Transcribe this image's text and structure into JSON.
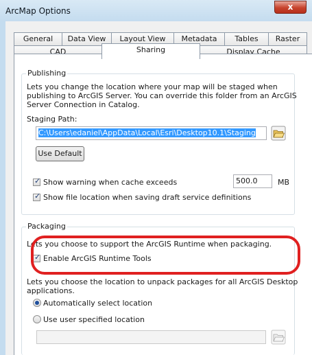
{
  "window": {
    "title": "ArcMap Options",
    "close_label": "x"
  },
  "tabs_row1": [
    "General",
    "Data View",
    "Layout View",
    "Metadata",
    "Tables",
    "Raster"
  ],
  "tabs_row2": [
    "CAD",
    "Sharing",
    "Display Cache"
  ],
  "active_tab": "Sharing",
  "publishing": {
    "title": "Publishing",
    "desc_line1": "Lets you change the location where your map will be staged when",
    "desc_line2": "publishing to ArcGIS Server. You can override this folder from an ArcGIS",
    "desc_line3": "Server Connection in Catalog.",
    "staging_label": "Staging Path:",
    "staging_value": "C:\\Users\\edaniel\\AppData\\Local\\Esri\\Desktop10.1\\Staging",
    "use_default": "Use Default",
    "warn_label": "Show warning when cache exceeds",
    "warn_checked": true,
    "cache_value": "500.0",
    "cache_unit": "MB",
    "show_location_label": "Show file location when saving draft service definitions",
    "show_location_checked": true
  },
  "packaging": {
    "title": "Packaging",
    "runtime_desc": "Lets you choose to support the ArcGIS Runtime when packaging.",
    "runtime_label": "Enable ArcGIS Runtime Tools",
    "runtime_checked": true,
    "unpack_line1": "Lets you choose the location to unpack packages for all ArcGIS Desktop",
    "unpack_line2": "applications.",
    "auto_label": "Automatically select location",
    "user_label": "Use user specified location",
    "auto_selected": true,
    "user_path": ""
  },
  "icons": {
    "folder": "folder-open-icon",
    "folder_disabled": "folder-open-disabled-icon"
  },
  "colors": {
    "highlight": "#e02020",
    "selection": "#3399ff",
    "titlebar": "#c4dcef"
  }
}
